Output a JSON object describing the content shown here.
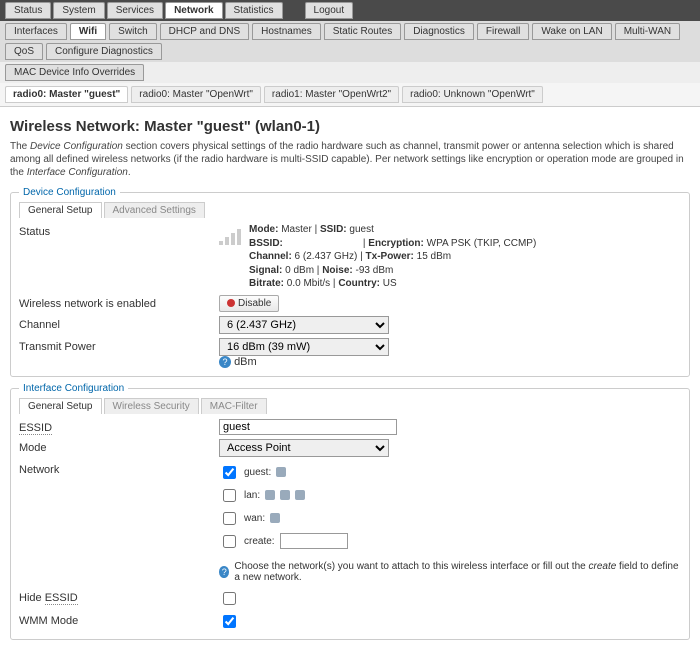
{
  "nav": {
    "top": [
      "Status",
      "System",
      "Services",
      "Network",
      "Statistics"
    ],
    "top_active": 3,
    "logout": "Logout",
    "sub": [
      "Interfaces",
      "Wifi",
      "Switch",
      "DHCP and DNS",
      "Hostnames",
      "Static Routes",
      "Diagnostics",
      "Firewall",
      "Wake on LAN",
      "Multi-WAN",
      "QoS",
      "Configure Diagnostics"
    ],
    "sub_active": 1,
    "sub2": "MAC Device Info Overrides",
    "radios": [
      "radio0: Master \"guest\"",
      "radio0: Master \"OpenWrt\"",
      "radio1: Master \"OpenWrt2\"",
      "radio0: Unknown \"OpenWrt\""
    ],
    "radios_active": 0
  },
  "page": {
    "title": "Wireless Network: Master \"guest\" (wlan0-1)",
    "desc_pre": "The ",
    "desc_em1": "Device Configuration",
    "desc_mid": " section covers physical settings of the radio hardware such as channel, transmit power or antenna selection which is shared among all defined wireless networks (if the radio hardware is multi-SSID capable). Per network settings like encryption or operation mode are grouped in the ",
    "desc_em2": "Interface Configuration",
    "desc_post": "."
  },
  "devcfg": {
    "legend": "Device Configuration",
    "tabs": [
      "General Setup",
      "Advanced Settings"
    ],
    "status_label": "Status",
    "status": {
      "mode_k": "Mode:",
      "mode_v": " Master | ",
      "ssid_k": "SSID:",
      "ssid_v": " guest",
      "bssid_k": "BSSID:",
      "bssid_v": "",
      "enc_k": "Encryption:",
      "enc_v": " WPA PSK (TKIP, CCMP)",
      "chan_k": "Channel:",
      "chan_v": " 6 (2.437 GHz) | ",
      "txp_k": "Tx-Power:",
      "txp_v": " 15 dBm",
      "sig_k": "Signal:",
      "sig_v": " 0 dBm | ",
      "noise_k": "Noise:",
      "noise_v": " -93 dBm",
      "bit_k": "Bitrate:",
      "bit_v": " 0.0 Mbit/s | ",
      "ctry_k": "Country:",
      "ctry_v": " US"
    },
    "enabled_text": "Wireless network is enabled",
    "disable_btn": "Disable",
    "channel_label": "Channel",
    "channel_value": "6 (2.437 GHz)",
    "txpower_label": "Transmit Power",
    "txpower_value": "16 dBm (39 mW)",
    "txpower_unit": "dBm"
  },
  "ifcfg": {
    "legend": "Interface Configuration",
    "tabs": [
      "General Setup",
      "Wireless Security",
      "MAC-Filter"
    ],
    "essid_label": "ESSID",
    "essid_value": "guest",
    "mode_label": "Mode",
    "mode_value": "Access Point",
    "network_label": "Network",
    "nets": [
      {
        "name": "guest:",
        "checked": true
      },
      {
        "name": "lan:",
        "checked": false
      },
      {
        "name": "wan:",
        "checked": false
      }
    ],
    "create_label": "create:",
    "net_hint": "Choose the network(s) you want to attach to this wireless interface or fill out the ",
    "net_hint_em": "create",
    "net_hint2": " field to define a new network.",
    "hide_label_pre": "Hide ",
    "hide_label_lnk": "ESSID",
    "wmm_label": "WMM Mode"
  }
}
